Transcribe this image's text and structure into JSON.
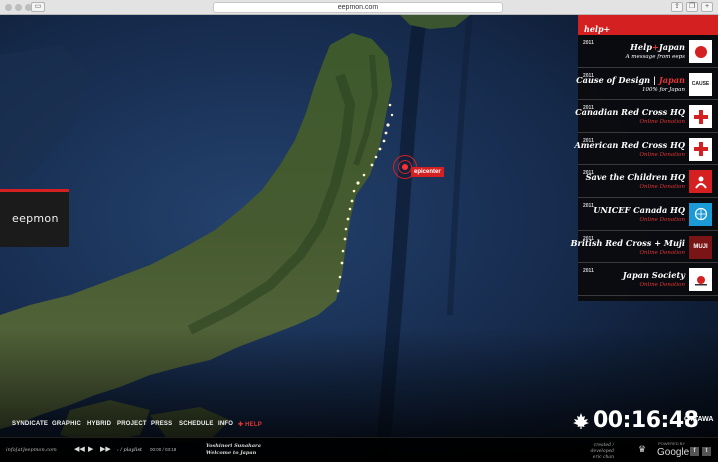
{
  "browser": {
    "url": "eepmon.com"
  },
  "logo": {
    "text": "eepmon"
  },
  "map": {
    "epicenter_label": "epicenter"
  },
  "panel": {
    "header": "help+",
    "entries": [
      {
        "year": "2011",
        "title": "Help+Japan",
        "title_parts": [
          "Help",
          "+",
          "Japan"
        ],
        "subtitle": "A message from eeps",
        "subtitle_red": false,
        "icon": "red-circle-logo-icon"
      },
      {
        "year": "2011",
        "title_parts": [
          "Cause of Design | ",
          "Japan",
          ""
        ],
        "subtitle": "100% for Japan",
        "subtitle_red": false,
        "icon": "cause-logo-icon",
        "icon_text": "CAUSE"
      },
      {
        "year": "2011",
        "title": "Canadian Red Cross HQ",
        "subtitle": "Online Donation",
        "subtitle_red": true,
        "icon": "red-cross-icon"
      },
      {
        "year": "2011",
        "title": "American Red Cross HQ",
        "subtitle": "Online Donation",
        "subtitle_red": true,
        "icon": "red-cross-icon"
      },
      {
        "year": "2011",
        "title": "Save the Children HQ",
        "subtitle": "Online Donation",
        "subtitle_red": true,
        "icon": "save-the-children-icon"
      },
      {
        "year": "2011",
        "title": "UNICEF Canada HQ",
        "subtitle": "Online Donation",
        "subtitle_red": true,
        "icon": "unicef-icon"
      },
      {
        "year": "2011",
        "title": "British Red Cross + Muji",
        "subtitle": "Online Donation",
        "subtitle_red": true,
        "icon": "muji-icon",
        "icon_text": "MUJI"
      },
      {
        "year": "2011",
        "title": "Japan Society",
        "subtitle": "Online Donation",
        "subtitle_red": true,
        "icon": "japan-society-icon"
      }
    ]
  },
  "nav": {
    "items": [
      "SYNDICATE",
      "GRAPHIC",
      "HYBRID",
      "PROJECT",
      "PRESS",
      "SCHEDULE",
      "INFO"
    ],
    "help": "HELP"
  },
  "clock": {
    "time": "00:16:48",
    "city": "OTTAWA"
  },
  "footer": {
    "email": "info[at]eepmon.com",
    "playlist": ": / playlist",
    "timecode": "00:00 / 03:18",
    "song_line1": "Yoshinori Sunahara",
    "song_line2": "Welcome to Japan",
    "credit_line1": "created / developed",
    "credit_line2": "eric chan",
    "powered": "POWERED BY",
    "google": "Google",
    "fb": "f",
    "tw": "t"
  },
  "colors": {
    "accent": "#d42020",
    "panel_bg": "#0a0a0c",
    "ocean": "#13284a",
    "land": "#3c4a2a"
  }
}
